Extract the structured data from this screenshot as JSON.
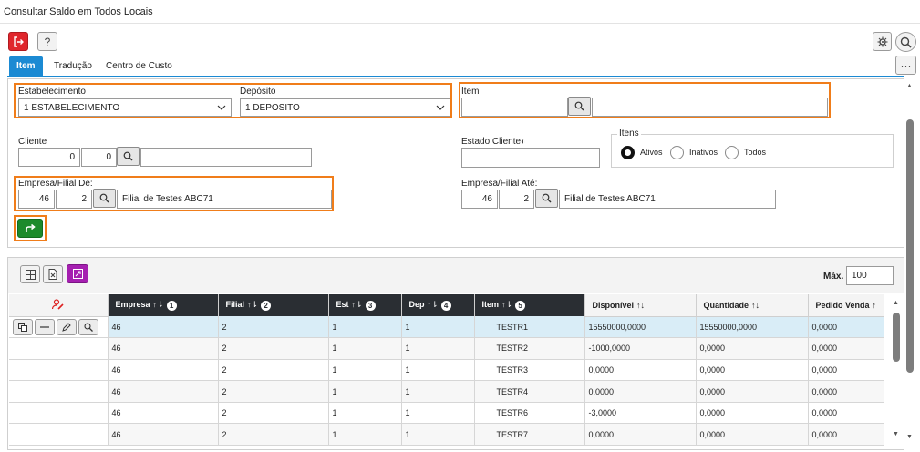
{
  "window": {
    "title": "Consultar Saldo em Todos Locais"
  },
  "toolbar": {
    "help_label": "?"
  },
  "tabs": [
    {
      "label": "Item",
      "active": true
    },
    {
      "label": "Tradução",
      "active": false
    },
    {
      "label": "Centro de Custo",
      "active": false
    }
  ],
  "filters": {
    "estabelecimento": {
      "label": "Estabelecimento",
      "value": "1 ESTABELECIMENTO"
    },
    "deposito": {
      "label": "Depósito",
      "value": "1 DEPOSITO"
    },
    "item": {
      "label": "Item",
      "value": ""
    },
    "cliente": {
      "label": "Cliente",
      "value1": "0",
      "value2": "0"
    },
    "estado_cliente": {
      "label": "Estado Cliente",
      "value": ""
    },
    "itens": {
      "legend": "Itens",
      "options": [
        "Ativos",
        "Inativos",
        "Todos"
      ],
      "selected": "Ativos"
    },
    "empresa_de": {
      "label": "Empresa/Filial De:",
      "empresa": "46",
      "filial": "2",
      "desc": "Filial de Testes ABC71"
    },
    "empresa_ate": {
      "label": "Empresa/Filial Até:",
      "empresa": "46",
      "filial": "2",
      "desc": "Filial de Testes ABC71"
    }
  },
  "grid": {
    "max_label": "Máx.",
    "max_value": "100",
    "columns": [
      {
        "label": "Empresa",
        "badge": "1"
      },
      {
        "label": "Filial",
        "badge": "2"
      },
      {
        "label": "Est",
        "badge": "3"
      },
      {
        "label": "Dep",
        "badge": "4"
      },
      {
        "label": "Item",
        "badge": "5"
      },
      {
        "label": "Disponível",
        "badge": ""
      },
      {
        "label": "Quantidade",
        "badge": ""
      },
      {
        "label": "Pedido Venda",
        "badge": ""
      }
    ],
    "rows": [
      [
        "46",
        "2",
        "1",
        "1",
        "TESTR1",
        "15550000,0000",
        "15550000,0000",
        "0,0000"
      ],
      [
        "46",
        "2",
        "1",
        "1",
        "TESTR2",
        "-1000,0000",
        "0,0000",
        "0,0000"
      ],
      [
        "46",
        "2",
        "1",
        "1",
        "TESTR3",
        "0,0000",
        "0,0000",
        "0,0000"
      ],
      [
        "46",
        "2",
        "1",
        "1",
        "TESTR4",
        "0,0000",
        "0,0000",
        "0,0000"
      ],
      [
        "46",
        "2",
        "1",
        "1",
        "TESTR6",
        "-3,0000",
        "0,0000",
        "0,0000"
      ],
      [
        "46",
        "2",
        "1",
        "1",
        "TESTR7",
        "0,0000",
        "0,0000",
        "0,0000"
      ]
    ]
  },
  "colors": {
    "accent": "#1b8ad3",
    "highlight": "#f07d1a",
    "exit": "#e0262c",
    "go": "#1c8a2b",
    "header": "#2a2e33"
  }
}
